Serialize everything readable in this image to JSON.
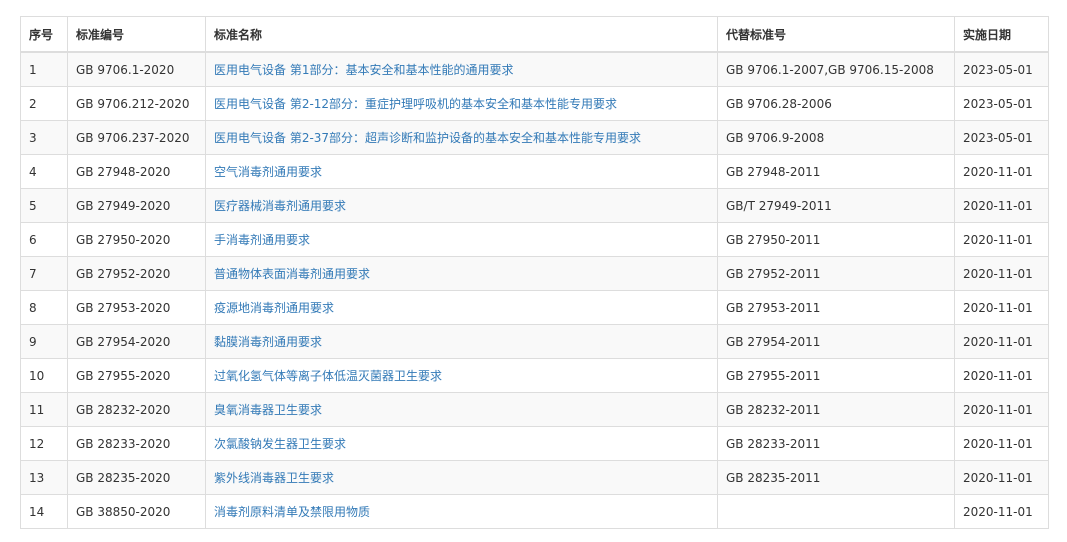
{
  "table": {
    "headers": {
      "index": "序号",
      "code": "标准编号",
      "name": "标准名称",
      "replaces": "代替标准号",
      "date": "实施日期"
    },
    "rows": [
      {
        "index": "1",
        "code": "GB 9706.1-2020",
        "name": "医用电气设备 第1部分：基本安全和基本性能的通用要求",
        "replaces": "GB 9706.1-2007,GB 9706.15-2008",
        "date": "2023-05-01"
      },
      {
        "index": "2",
        "code": "GB 9706.212-2020",
        "name": "医用电气设备 第2-12部分：重症护理呼吸机的基本安全和基本性能专用要求",
        "replaces": "GB 9706.28-2006",
        "date": "2023-05-01"
      },
      {
        "index": "3",
        "code": "GB 9706.237-2020",
        "name": "医用电气设备 第2-37部分：超声诊断和监护设备的基本安全和基本性能专用要求",
        "replaces": "GB 9706.9-2008",
        "date": "2023-05-01"
      },
      {
        "index": "4",
        "code": "GB 27948-2020",
        "name": "空气消毒剂通用要求",
        "replaces": "GB 27948-2011",
        "date": "2020-11-01"
      },
      {
        "index": "5",
        "code": "GB 27949-2020",
        "name": "医疗器械消毒剂通用要求",
        "replaces": "GB/T 27949-2011",
        "date": "2020-11-01"
      },
      {
        "index": "6",
        "code": "GB 27950-2020",
        "name": "手消毒剂通用要求",
        "replaces": "GB 27950-2011",
        "date": "2020-11-01"
      },
      {
        "index": "7",
        "code": "GB 27952-2020",
        "name": "普通物体表面消毒剂通用要求",
        "replaces": "GB 27952-2011",
        "date": "2020-11-01"
      },
      {
        "index": "8",
        "code": "GB 27953-2020",
        "name": "疫源地消毒剂通用要求",
        "replaces": "GB 27953-2011",
        "date": "2020-11-01"
      },
      {
        "index": "9",
        "code": "GB 27954-2020",
        "name": "黏膜消毒剂通用要求",
        "replaces": "GB 27954-2011",
        "date": "2020-11-01"
      },
      {
        "index": "10",
        "code": "GB 27955-2020",
        "name": "过氧化氢气体等离子体低温灭菌器卫生要求",
        "replaces": "GB 27955-2011",
        "date": "2020-11-01"
      },
      {
        "index": "11",
        "code": "GB 28232-2020",
        "name": "臭氧消毒器卫生要求",
        "replaces": "GB 28232-2011",
        "date": "2020-11-01"
      },
      {
        "index": "12",
        "code": "GB 28233-2020",
        "name": "次氯酸钠发生器卫生要求",
        "replaces": "GB 28233-2011",
        "date": "2020-11-01"
      },
      {
        "index": "13",
        "code": "GB 28235-2020",
        "name": "紫外线消毒器卫生要求",
        "replaces": "GB 28235-2011",
        "date": "2020-11-01"
      },
      {
        "index": "14",
        "code": "GB 38850-2020",
        "name": "消毒剂原料清单及禁限用物质",
        "replaces": "",
        "date": "2020-11-01"
      }
    ]
  },
  "colors": {
    "link": "#337ab7",
    "text": "#333333",
    "border": "#dddddd",
    "stripe": "#f9f9f9"
  }
}
